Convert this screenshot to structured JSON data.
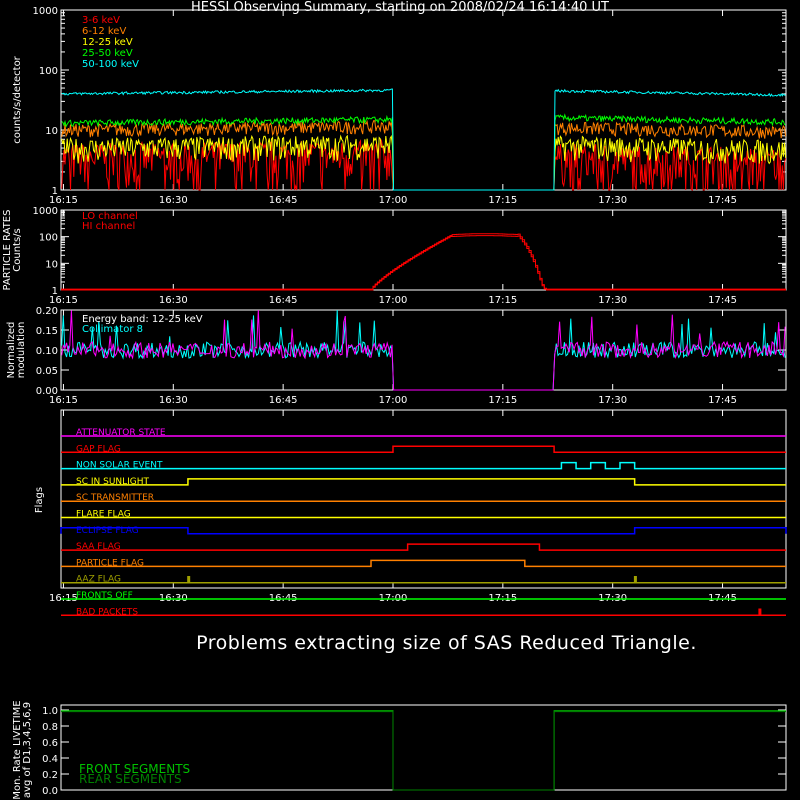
{
  "title": "HESSI Observing Summary, starting on 2008/02/24 16:14:40 UT",
  "message": "Problems extracting size of SAS Reduced Triangle.",
  "time_ticks": [
    "16:15",
    "16:30",
    "16:45",
    "17:00",
    "17:15",
    "17:30",
    "17:45"
  ],
  "colors": {
    "red": "#ff0000",
    "orange": "#ff8000",
    "yellow": "#ffff00",
    "green": "#00ff00",
    "cyan": "#00ffff",
    "magenta": "#ff00ff",
    "blue": "#0000ff",
    "white": "#ffffff",
    "lime": "#00c000",
    "darkgreen": "#008000",
    "olive": "#a0a000"
  },
  "chart_data": [
    {
      "type": "line",
      "panel": "count-rates",
      "ylabel": "counts/s/detector",
      "yscale": "log",
      "ylim": [
        1,
        1000
      ],
      "yticks": [
        "1",
        "10",
        "100",
        "1000"
      ],
      "x_range": [
        "16:14:40",
        "17:53:40"
      ],
      "data_gap": [
        "17:00",
        "17:22"
      ],
      "series": [
        {
          "name": "3-6 keV",
          "color": "#ff0000",
          "before_gap": 3.5,
          "after_gap": 3.5
        },
        {
          "name": "6-12 keV",
          "color": "#ff8000",
          "before_gap": 10,
          "after_gap": 11
        },
        {
          "name": "12-25 keV",
          "color": "#ffff00",
          "before_gap": 5,
          "after_gap": 5.5
        },
        {
          "name": "25-50 keV",
          "color": "#00ff00",
          "before_gap": 13,
          "after_gap": 16
        },
        {
          "name": "50-100 keV",
          "color": "#00ffff",
          "before_gap": 40,
          "after_gap": 45
        }
      ]
    },
    {
      "type": "line",
      "panel": "particle-rates",
      "ylabel": "PARTICLE RATES Counts/s",
      "yscale": "log",
      "ylim": [
        1,
        1000
      ],
      "yticks": [
        "1",
        "10",
        "100",
        "1000"
      ],
      "series": [
        {
          "name": "LO channel",
          "color": "#ff0000",
          "peak": 110,
          "rise": [
            "16:57",
            "17:08"
          ],
          "fall": [
            "17:17",
            "17:21"
          ]
        },
        {
          "name": "HI channel",
          "color": "#ff0000",
          "peak": 120
        }
      ]
    },
    {
      "type": "line",
      "panel": "modulation",
      "ylabel": "Normalized modulation",
      "ylim": [
        0,
        0.2
      ],
      "yticks": [
        "0.00",
        "0.05",
        "0.10",
        "0.15",
        "0.20"
      ],
      "annotation": "Energy band: 12-25 keV",
      "series": [
        {
          "name": "Collimator 8",
          "color": "#00ffff",
          "mean": 0.1
        },
        {
          "name": "",
          "color": "#ff00ff",
          "mean": 0.1
        }
      ]
    },
    {
      "type": "line",
      "panel": "flags",
      "ylabel": "Flags",
      "flags": [
        {
          "name": "ATTENUATOR STATE",
          "color": "#ff00ff",
          "on": []
        },
        {
          "name": "GAP FLAG",
          "color": "#ff0000",
          "on": [
            [
              "17:00",
              "17:22"
            ]
          ]
        },
        {
          "name": "NON SOLAR EVENT",
          "color": "#00ffff",
          "on": [
            [
              "17:23",
              "17:25"
            ],
            [
              "17:27",
              "17:29"
            ],
            [
              "17:31",
              "17:33"
            ]
          ]
        },
        {
          "name": "SC IN SUNLIGHT",
          "color": "#ffff00",
          "on": [
            [
              "16:32",
              "17:33"
            ]
          ]
        },
        {
          "name": "SC TRANSMITTER",
          "color": "#ff8000",
          "on": []
        },
        {
          "name": "FLARE FLAG",
          "color": "#ffff00",
          "on": []
        },
        {
          "name": "ECLIPSE FLAG",
          "color": "#0000ff",
          "on": [
            [
              "16:14:40",
              "16:32"
            ],
            [
              "17:33",
              "17:53:40"
            ]
          ]
        },
        {
          "name": "SAA FLAG",
          "color": "#ff0000",
          "on": [
            [
              "17:02",
              "17:20"
            ]
          ]
        },
        {
          "name": "PARTICLE FLAG",
          "color": "#ff8000",
          "on": [
            [
              "16:57",
              "17:18"
            ]
          ]
        },
        {
          "name": "AAZ FLAG",
          "color": "#a0a000",
          "on": [
            [
              "16:32",
              "16:32"
            ],
            [
              "17:33",
              "17:33"
            ]
          ]
        },
        {
          "name": "FRONTS OFF",
          "color": "#00ff00",
          "on": []
        },
        {
          "name": "BAD PACKETS",
          "color": "#ff0000",
          "on": [
            [
              "17:50",
              "17:50"
            ]
          ]
        }
      ]
    },
    {
      "type": "line",
      "panel": "livetime",
      "ylabel": "Mon. Rate LIVETIME avg of D1,3,4,5,6,9",
      "ylim": [
        0,
        1.0
      ],
      "yticks": [
        "0.0",
        "0.2",
        "0.4",
        "0.6",
        "0.8",
        "1.0"
      ],
      "series": [
        {
          "name": "FRONT SEGMENTS",
          "color": "#00c000",
          "before_gap": 0.99,
          "after_gap": 0.99
        },
        {
          "name": "REAR SEGMENTS",
          "color": "#008000",
          "before_gap": 0.98,
          "after_gap": 0.98
        }
      ]
    }
  ]
}
